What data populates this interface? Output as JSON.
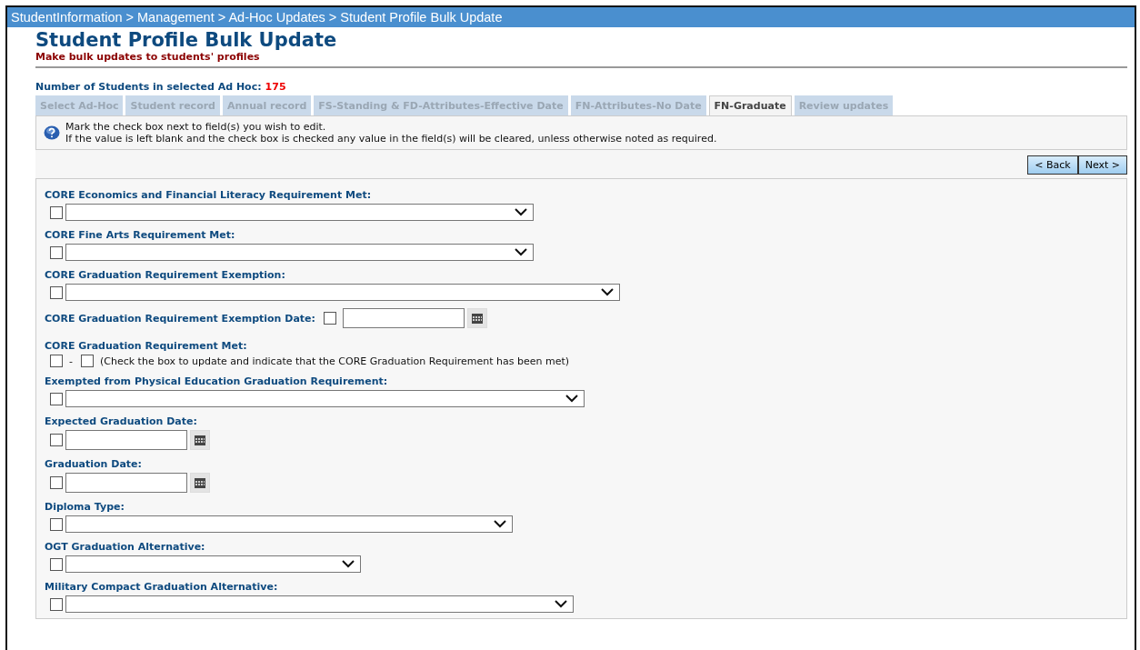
{
  "breadcrumb": "StudentInformation > Management > Ad-Hoc Updates > Student Profile Bulk Update",
  "title": "Student Profile Bulk Update",
  "subtitle": "Make bulk updates to students' profiles",
  "count": {
    "label": "Number of Students in selected Ad Hoc:",
    "value": "175"
  },
  "tabs": [
    {
      "label": "Select Ad-Hoc",
      "selected": false
    },
    {
      "label": "Student record",
      "selected": false
    },
    {
      "label": "Annual record",
      "selected": false
    },
    {
      "label": "FS-Standing & FD-Attributes-Effective Date",
      "selected": false
    },
    {
      "label": "FN-Attributes-No Date",
      "selected": false
    },
    {
      "label": "FN-Graduate",
      "selected": true
    },
    {
      "label": "Review updates",
      "selected": false
    }
  ],
  "info": [
    "Mark the check box next to field(s) you wish to edit.",
    "If the value is left blank and the check box is checked any value in the field(s) will be cleared, unless otherwise noted as required."
  ],
  "buttons": [
    "< Back",
    "Next >"
  ],
  "fields": [
    {
      "kind": "select",
      "label": "CORE Economics and Financial Literacy Requirement Met:",
      "checked": false
    },
    {
      "kind": "select",
      "label": "CORE Fine Arts Requirement Met:",
      "checked": false,
      "focused": false
    },
    {
      "kind": "select",
      "label": "CORE Graduation Requirement Exemption:",
      "checked": false,
      "focused": false
    },
    {
      "kind": "inline-date",
      "label": "CORE Graduation Requirement Exemption Date:",
      "checked": false,
      "focused": false
    },
    {
      "kind": "met",
      "label": "CORE Graduation Requirement Met:",
      "checked": false,
      "focused": false,
      "separator": "-",
      "met": false,
      "note": "(Check the box to update and indicate that the CORE Graduation Requirement has been met)"
    },
    {
      "kind": "select",
      "label": "Exempted from Physical Education Graduation Requirement:",
      "checked": false,
      "focused": false
    },
    {
      "kind": "date",
      "label": "Expected Graduation Date:",
      "checked": false,
      "focused": false
    },
    {
      "kind": "date",
      "label": "Graduation Date:",
      "checked": false,
      "focused": false
    },
    {
      "kind": "select",
      "label": "Diploma Type:",
      "checked": false,
      "focused": false
    },
    {
      "kind": "select",
      "label": "OGT Graduation Alternative:",
      "checked": false,
      "focused": false
    },
    {
      "kind": "select",
      "label": "Military Compact Graduation Alternative:",
      "checked": false,
      "focused": false
    }
  ]
}
